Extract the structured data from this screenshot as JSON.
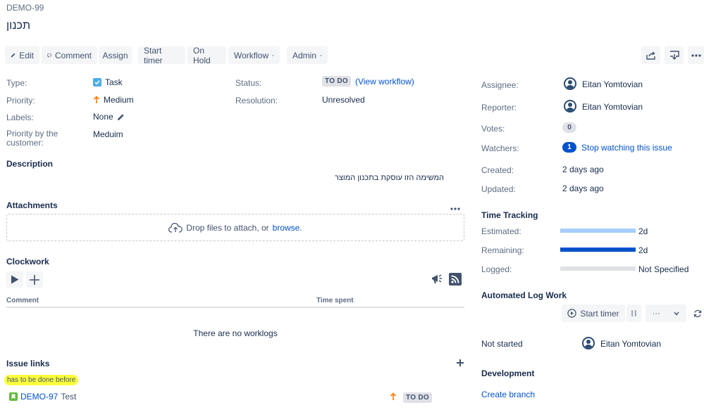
{
  "issue": {
    "key": "DEMO-99",
    "title": "תכנון"
  },
  "toolbar": {
    "edit": "Edit",
    "comment": "Comment",
    "assign": "Assign",
    "start_timer": "Start timer",
    "on_hold": "On Hold",
    "workflow": "Workflow",
    "admin": "Admin"
  },
  "details": {
    "type_label": "Type:",
    "type_value": "Task",
    "priority_label": "Priority:",
    "priority_value": "Medium",
    "labels_label": "Labels:",
    "labels_value": "None",
    "pbc_label": "Priority by the customer:",
    "pbc_value": "Meduim",
    "status_label": "Status:",
    "status_value": "TO DO",
    "view_workflow": "(View workflow)",
    "resolution_label": "Resolution:",
    "resolution_value": "Unresolved"
  },
  "description": {
    "heading": "Description",
    "text": "המשימה הזו עוסקת בתכנון המוצר"
  },
  "attachments": {
    "heading": "Attachments",
    "drop_text": "Drop files to attach, or",
    "browse": "browse."
  },
  "clockwork": {
    "heading": "Clockwork",
    "col_comment": "Comment",
    "col_time_spent": "Time spent",
    "empty": "There are no worklogs"
  },
  "issue_links": {
    "heading": "Issue links",
    "relation": "has to be done before",
    "item_key": "DEMO-97",
    "item_title": "Test",
    "item_status": "TO DO"
  },
  "people": {
    "assignee_label": "Assignee:",
    "assignee": "Eitan Yomtovian",
    "reporter_label": "Reporter:",
    "reporter": "Eitan Yomtovian",
    "votes_label": "Votes:",
    "votes": "0",
    "watchers_label": "Watchers:",
    "watchers": "1",
    "stop_watching": "Stop watching this issue"
  },
  "dates": {
    "created_label": "Created:",
    "created": "2 days ago",
    "updated_label": "Updated:",
    "updated": "2 days ago"
  },
  "time_tracking": {
    "heading": "Time Tracking",
    "estimated_label": "Estimated:",
    "estimated": "2d",
    "estimated_fraction": 1.0,
    "remaining_label": "Remaining:",
    "remaining": "2d",
    "remaining_fraction": 1.0,
    "logged_label": "Logged:",
    "logged": "Not Specified",
    "logged_fraction": 0.0,
    "colors": {
      "estimated": "#a6ceff",
      "remaining": "#0052cc",
      "track": "#dfe1e6"
    }
  },
  "automated_log_work": {
    "heading": "Automated Log Work",
    "start_timer": "Start timer",
    "more": "···",
    "state": "Not started",
    "user": "Eitan Yomtovian"
  },
  "development": {
    "heading": "Development",
    "create_branch": "Create branch"
  }
}
